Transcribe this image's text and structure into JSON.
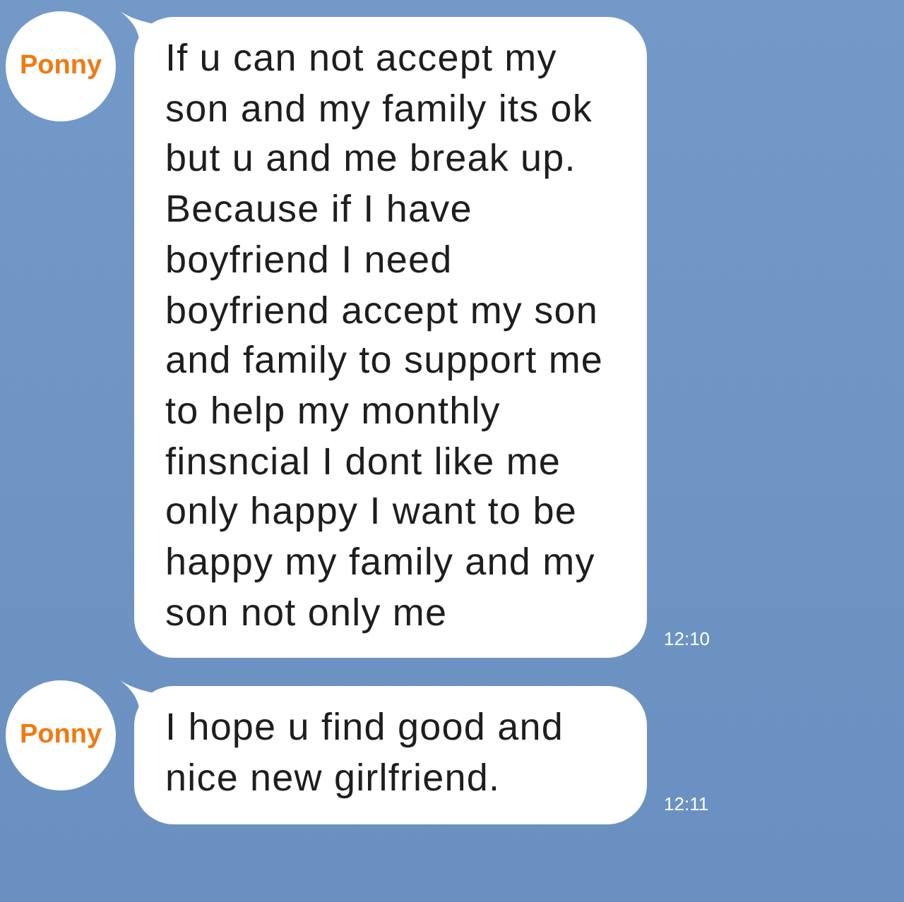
{
  "messages": [
    {
      "sender": "Ponny",
      "text": "If u can not accept my son and my family its ok but u and me break up. Because if I have boyfriend I need boyfriend accept my son and family to support me to help my monthly finsncial I dont like me only happy I want to be happy my family and my son not only me",
      "time": "12:10"
    },
    {
      "sender": "Ponny",
      "text": "I hope u find good and nice new girlfriend.",
      "time": "12:11"
    }
  ]
}
